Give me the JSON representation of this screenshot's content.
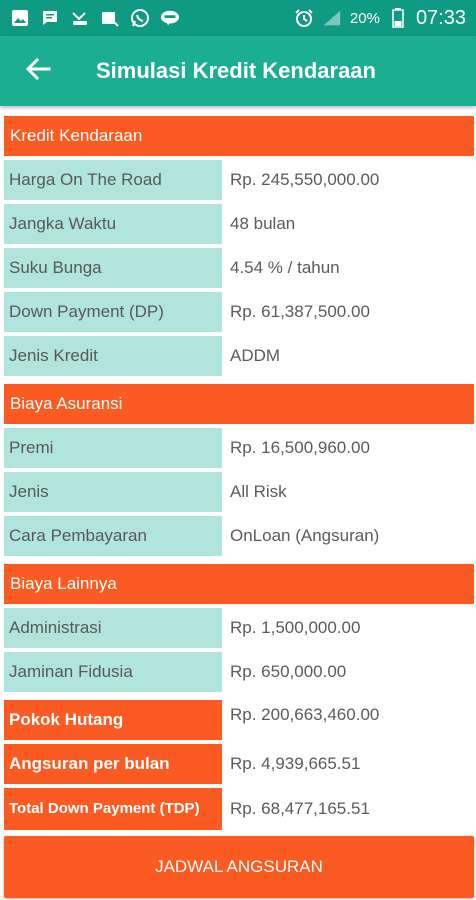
{
  "status_bar": {
    "battery_percent": "20%",
    "time": "07:33",
    "icons": [
      "image-icon",
      "message-icon",
      "missed-call-icon",
      "call-icon",
      "whatsapp-icon",
      "line-icon",
      "alarm-icon",
      "signal-icon",
      "battery-icon"
    ]
  },
  "app_bar": {
    "title": "Simulasi Kredit Kendaraan",
    "back_icon": "arrow-left-icon"
  },
  "sections": {
    "kredit": {
      "title": "Kredit Kendaraan",
      "rows": [
        {
          "label": "Harga On The Road",
          "value": "Rp. 245,550,000.00"
        },
        {
          "label": "Jangka Waktu",
          "value": "48 bulan"
        },
        {
          "label": "Suku Bunga",
          "value": "4.54 % / tahun"
        },
        {
          "label": "Down Payment (DP)",
          "value": "Rp. 61,387,500.00"
        },
        {
          "label": "Jenis Kredit",
          "value": "ADDM"
        }
      ]
    },
    "asuransi": {
      "title": "Biaya Asuransi",
      "rows": [
        {
          "label": "Premi",
          "value": "Rp. 16,500,960.00"
        },
        {
          "label": "Jenis",
          "value": "All Risk"
        },
        {
          "label": "Cara Pembayaran",
          "value": "OnLoan (Angsuran)"
        }
      ]
    },
    "lainnya": {
      "title": "Biaya Lainnya",
      "rows": [
        {
          "label": "Administrasi",
          "value": "Rp. 1,500,000.00"
        },
        {
          "label": "Jaminan Fidusia",
          "value": "Rp. 650,000.00"
        }
      ]
    },
    "summary": {
      "rows": [
        {
          "label": "Pokok Hutang",
          "value": "Rp. 200,663,460.00"
        },
        {
          "label": "Angsuran per bulan",
          "value": "Rp. 4,939,665.51"
        },
        {
          "label": "Total Down Payment (TDP)",
          "value": "Rp. 68,477,165.51"
        }
      ]
    }
  },
  "footer": {
    "button_label": "JADWAL ANGSURAN"
  },
  "colors": {
    "status_bar": "#0f9a82",
    "app_bar": "#1cae93",
    "accent_orange": "#fb5b22",
    "label_bg": "#b0e4dc"
  }
}
